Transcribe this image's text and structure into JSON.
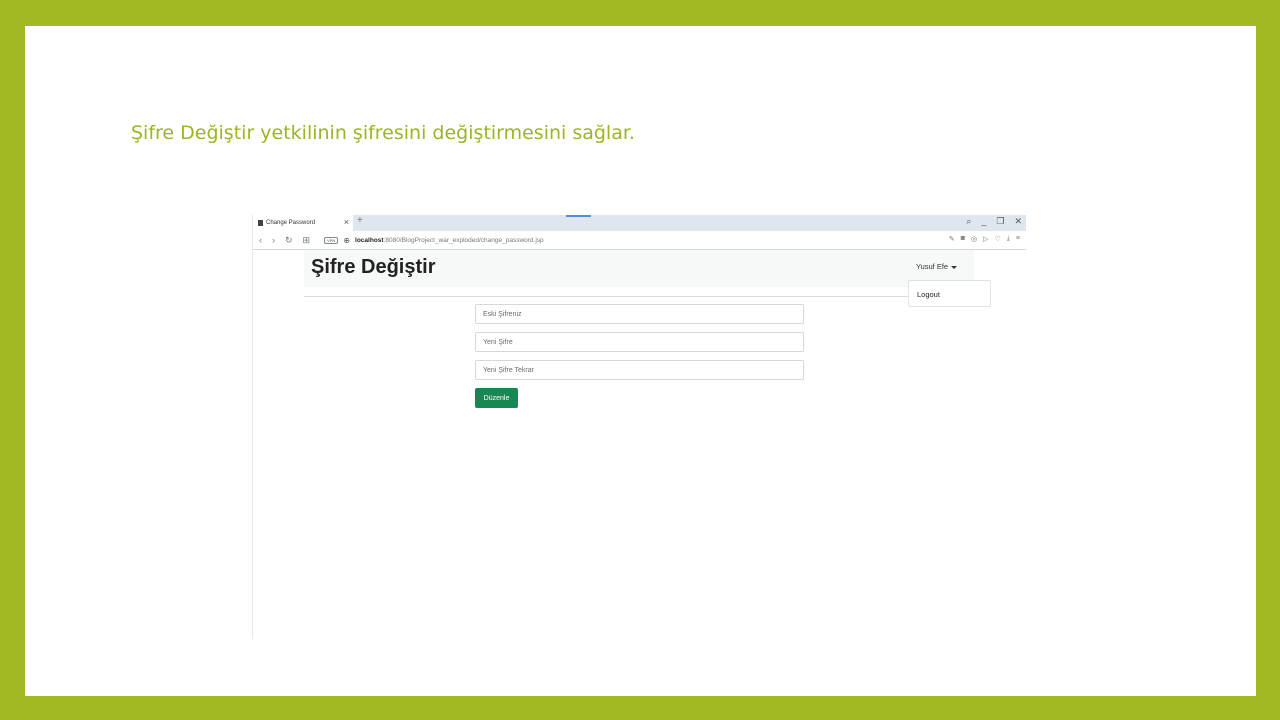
{
  "slide": {
    "title": "Şifre Değiştir yetkilinin şifresini değiştirmesini sağlar."
  },
  "browser": {
    "tab_title": "Change Password",
    "url_host": "localhost",
    "url_rest": ":8080/BlogProject_war_exploded/change_password.jsp",
    "vpn_label": "VPN"
  },
  "navbar": {
    "brand": "Şifre Değiştir",
    "user": "Yusuf Efe",
    "dropdown_items": [
      "Logout"
    ]
  },
  "form": {
    "old_password_placeholder": "Eski Şifreniz",
    "new_password_placeholder": "Yeni Şifre",
    "repeat_password_placeholder": "Yeni Şifre Tekrar",
    "submit_label": "Düzenle"
  },
  "colors": {
    "frame": "#a4b823",
    "title": "#9bb523",
    "submit": "#198754"
  }
}
